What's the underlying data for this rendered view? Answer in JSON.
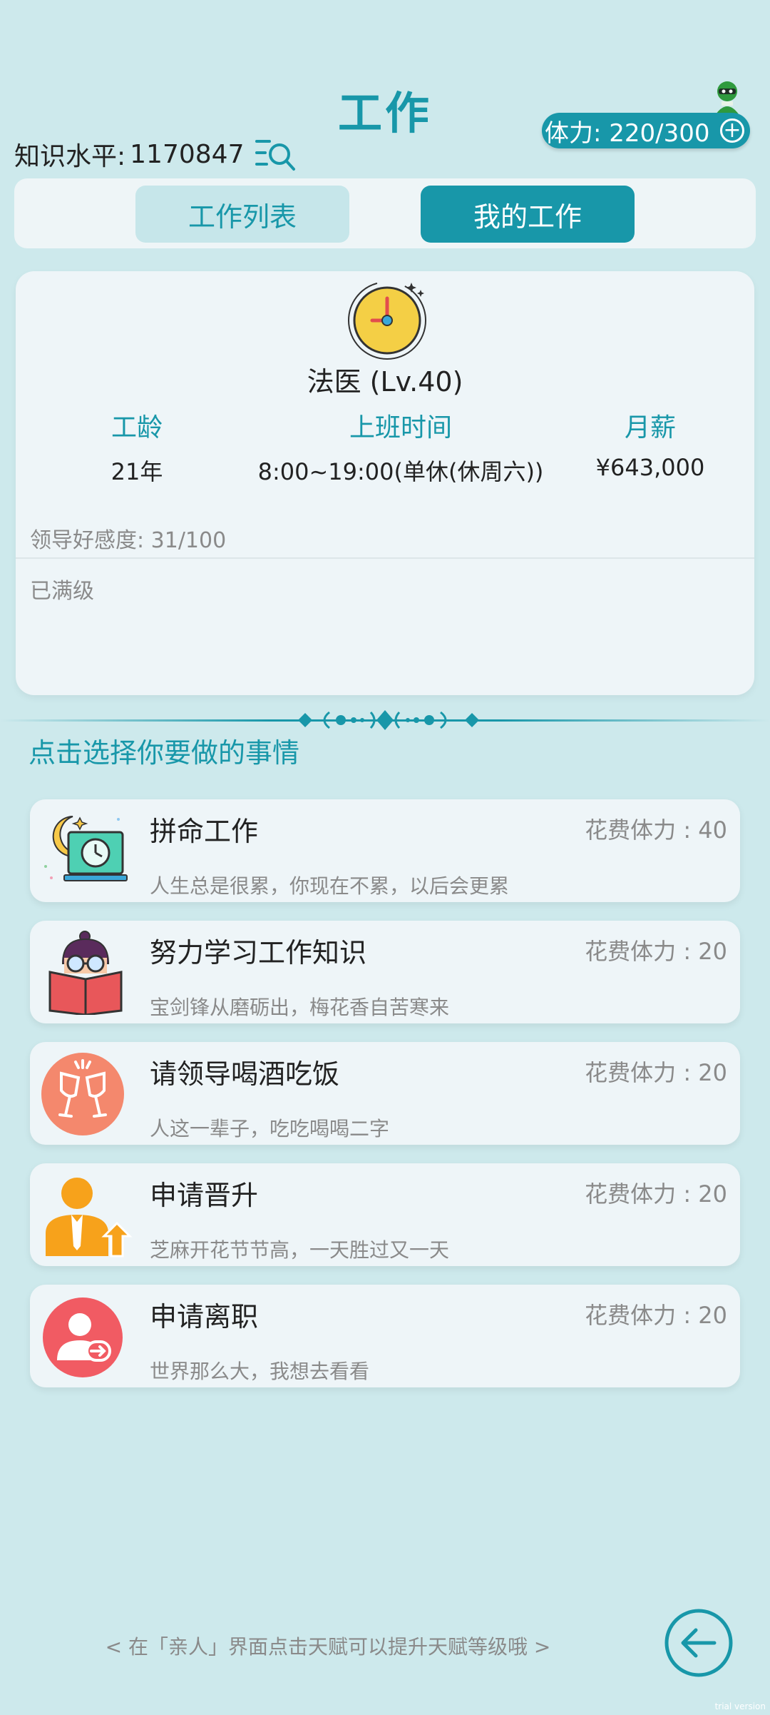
{
  "header": {
    "title": "工作",
    "knowledge_label": "知识水平:",
    "knowledge_value": "1170847",
    "stamina": "体力: 220/300",
    "stamina_plus": "+"
  },
  "tabs": [
    {
      "label": "工作列表",
      "active": false
    },
    {
      "label": "我的工作",
      "active": true
    }
  ],
  "job": {
    "name": "法医 (Lv.40)",
    "stats": [
      {
        "key": "工龄",
        "value": "21年"
      },
      {
        "key": "上班时间",
        "value": "8:00~19:00(单休(休周六))"
      },
      {
        "key": "月薪",
        "value": "¥643,000"
      }
    ],
    "favor": "领导好感度: 31/100",
    "level_status": "已满级"
  },
  "prompt": "点击选择你要做的事情",
  "actions": [
    {
      "name": "拼命工作",
      "cost": "花费体力 : 40",
      "desc": "人生总是很累，你现在不累，以后会更累",
      "icon": "night-work-icon"
    },
    {
      "name": "努力学习工作知识",
      "cost": "花费体力 : 20",
      "desc": "宝剑锋从磨砺出，梅花香自苦寒来",
      "icon": "study-book-icon"
    },
    {
      "name": "请领导喝酒吃饭",
      "cost": "花费体力 : 20",
      "desc": "人这一辈子，吃吃喝喝二字",
      "icon": "cheers-icon"
    },
    {
      "name": "申请晋升",
      "cost": "花费体力 : 20",
      "desc": "芝麻开花节节高，一天胜过又一天",
      "icon": "promotion-icon"
    },
    {
      "name": "申请离职",
      "cost": "花费体力 : 20",
      "desc": "世界那么大，我想去看看",
      "icon": "resign-icon"
    }
  ],
  "footer": {
    "hint": "< 在「亲人」界面点击天赋可以提升天赋等级哦 >",
    "watermark": "trial version"
  },
  "colors": {
    "accent": "#1897a9",
    "background": "#cde9ec",
    "card": "#eef5f8"
  }
}
